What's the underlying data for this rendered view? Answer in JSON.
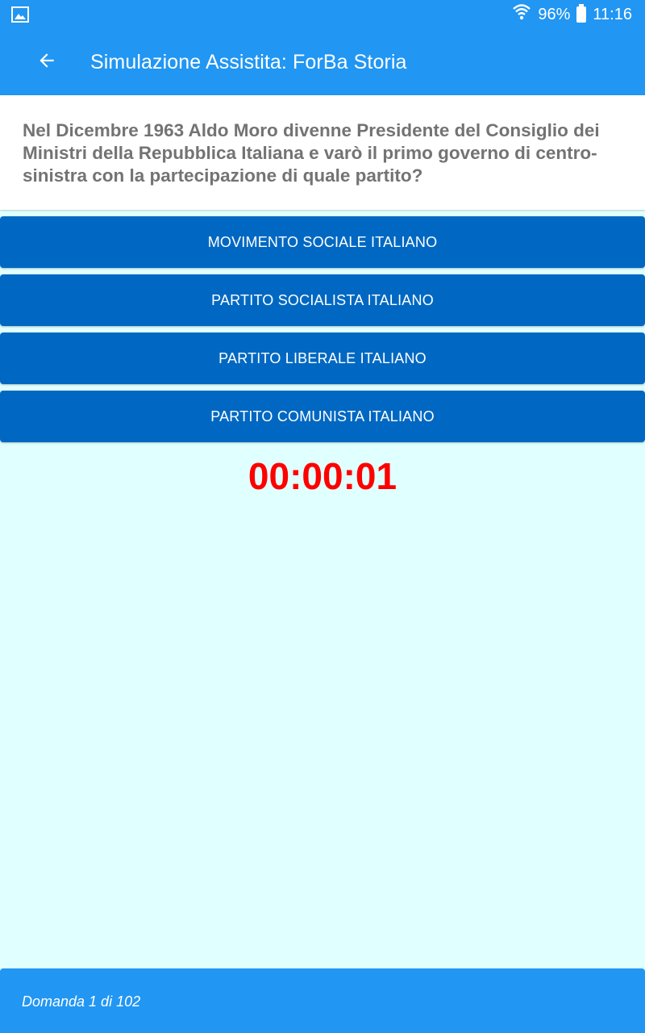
{
  "status_bar": {
    "battery": "96%",
    "time": "11:16",
    "icons": [
      "image-notification-icon",
      "wifi-icon",
      "battery-icon"
    ]
  },
  "app_bar": {
    "title": "Simulazione Assistita: ForBa Storia",
    "back_icon": "arrow-left-icon"
  },
  "question": {
    "text": "Nel Dicembre 1963 Aldo Moro divenne Presidente del Consiglio dei Ministri della Repubblica Italiana e varò il primo governo di centro-sinistra con la partecipazione di quale partito?"
  },
  "answers": [
    {
      "label": "MOVIMENTO SOCIALE ITALIANO"
    },
    {
      "label": "PARTITO SOCIALISTA ITALIANO"
    },
    {
      "label": "PARTITO LIBERALE ITALIANO"
    },
    {
      "label": "PARTITO COMUNISTA ITALIANO"
    }
  ],
  "timer": "00:00:01",
  "footer": {
    "progress_text": "Domanda 1 di 102"
  },
  "colors": {
    "primary": "#2196f3",
    "answer_button": "#0068c2",
    "background": "#e0ffff",
    "timer": "#ff0000",
    "question_text": "#737373"
  }
}
